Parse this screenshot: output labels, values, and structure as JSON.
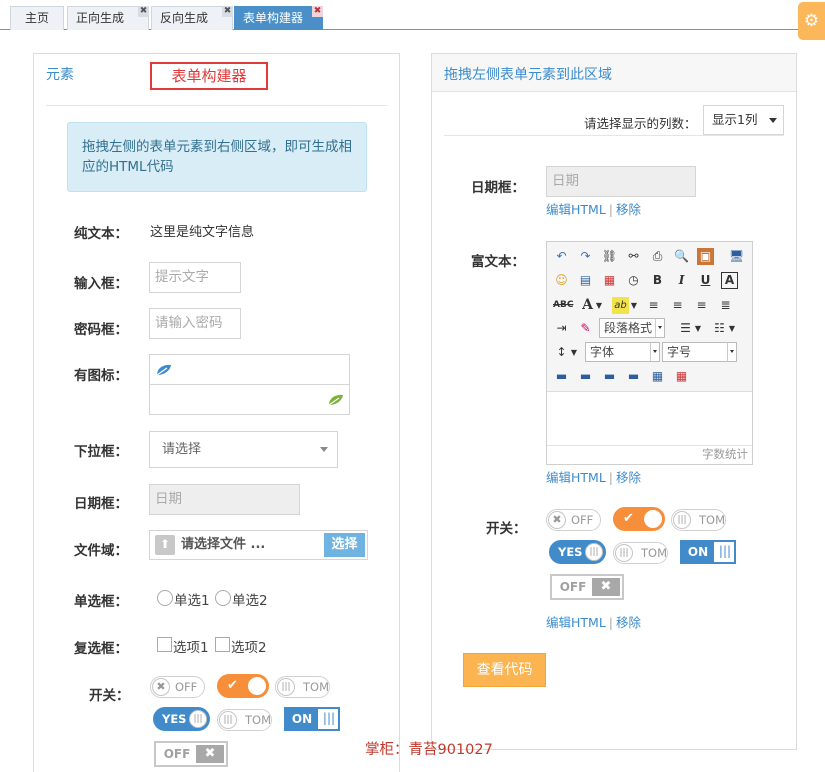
{
  "tabs": [
    {
      "label": "主页",
      "closable": false,
      "active": false
    },
    {
      "label": "正向生成",
      "closable": true,
      "active": false
    },
    {
      "label": "反向生成",
      "closable": true,
      "active": false
    },
    {
      "label": "表单构建器",
      "closable": true,
      "active": true
    }
  ],
  "tab_close_glyph": "✖",
  "settings_icon": "gear-icon",
  "left_panel": {
    "title": "元素",
    "builder_label": "表单构建器",
    "info_text": "拖拽左侧的表单元素到右侧区域，即可生成相应的HTML代码",
    "fields": {
      "plain_text": {
        "label": "纯文本：",
        "value": "这里是纯文字信息"
      },
      "input": {
        "label": "输入框：",
        "placeholder": "提示文字"
      },
      "password": {
        "label": "密码框：",
        "placeholder": "请输入密码"
      },
      "icon_input": {
        "label": "有图标：",
        "icon_left": "leaf-icon",
        "icon_right": "leaf-icon"
      },
      "select": {
        "label": "下拉框：",
        "value": "请选择"
      },
      "date": {
        "label": "日期框：",
        "placeholder": "日期"
      },
      "file": {
        "label": "文件域：",
        "text": "请选择文件 ...",
        "button": "选择"
      },
      "radio": {
        "label": "单选框：",
        "options": [
          "单选1",
          "单选2"
        ]
      },
      "checkbox": {
        "label": "复选框：",
        "options": [
          "选项1",
          "选项2"
        ]
      },
      "switch": {
        "label": "开关："
      }
    }
  },
  "switches": {
    "off_text": "OFF",
    "tom_text": "TOM",
    "yes_text": "YES",
    "on_text": "ON",
    "off_box_text": "OFF",
    "check_glyph": "✔",
    "x_glyph": "✖",
    "bars_glyph": "|||"
  },
  "right_panel": {
    "title": "拖拽左侧表单元素到此区域",
    "columns_label": "请选择显示的列数：",
    "columns_value": "显示1列",
    "date": {
      "label": "日期框：",
      "placeholder": "日期"
    },
    "rich_text": {
      "label": "富文本：",
      "paragraph_format": "段落格式",
      "font": "字体",
      "font_size": "字号",
      "word_count": "字数统计"
    },
    "switch_label": "开关：",
    "edit_html": "编辑HTML",
    "remove": "移除",
    "separator": "|",
    "view_code": "查看代码"
  },
  "watermark": "掌柜：青苔901027"
}
